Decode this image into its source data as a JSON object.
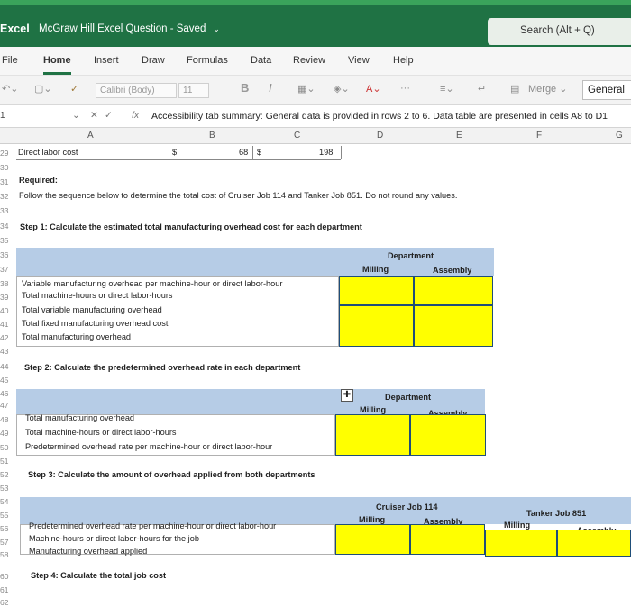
{
  "titlebar": {
    "app": "Excel",
    "doc_title": "McGraw Hill Excel Question - Saved",
    "search": "Search (Alt + Q)"
  },
  "menu": [
    "File",
    "Home",
    "Insert",
    "Draw",
    "Formulas",
    "Data",
    "Review",
    "View",
    "Help"
  ],
  "ribbon": {
    "font": "Calibri (Body)",
    "size": "11",
    "bold": "B",
    "italic": "I",
    "more": "···",
    "merge": "Merge",
    "number_format": "General"
  },
  "formula_bar": {
    "cell": "1",
    "fx": "fx",
    "content": "Accessibility tab summary: General data is provided in rows 2 to 6. Data table are presented in cells A8 to D1"
  },
  "columns": [
    "A",
    "B",
    "C",
    "D",
    "E",
    "F",
    "G"
  ],
  "row_numbers": [
    "29",
    "30",
    "31",
    "32",
    "33",
    "34",
    "35",
    "36",
    "37",
    "38",
    "39",
    "40",
    "41",
    "42",
    "43",
    "44",
    "45",
    "46",
    "47",
    "48",
    "49",
    "50",
    "51",
    "52",
    "53",
    "54",
    "55",
    "56",
    "57",
    "58",
    "59",
    "60",
    "61",
    "62"
  ],
  "row29": {
    "label": "Direct labor cost",
    "cur1": "$",
    "val1": "68",
    "cur2": "$",
    "val2": "198"
  },
  "required": {
    "title": "Required:",
    "text": "Follow the sequence below to determine the total cost of Cruiser Job 114 and Tanker Job 851. Do not round any values."
  },
  "step1": {
    "title": "Step 1: Calculate the estimated total manufacturing overhead cost for each department",
    "department": "Department",
    "milling": "Milling",
    "assembly": "Assembly",
    "rows": [
      "Variable manufacturing overhead per machine-hour or direct labor-hour",
      "Total machine-hours or direct labor-hours",
      "Total variable manufacturing overhead",
      "Total fixed manufacturing overhead cost",
      "Total manufacturing overhead"
    ]
  },
  "step2": {
    "title": "Step 2: Calculate the predetermined overhead rate in each department",
    "department": "Department",
    "milling": "Milling",
    "assembly": "Assembly",
    "rows": [
      "Total manufacturing overhead",
      "Total machine-hours or direct labor-hours",
      "Predetermined overhead rate per machine-hour or direct labor-hour"
    ]
  },
  "step3": {
    "title": "Step 3: Calculate the amount of overhead applied from both departments",
    "job1": "Cruiser Job 114",
    "job2": "Tanker Job 851",
    "milling": "Milling",
    "assembly": "Assembly",
    "rows": [
      "Predetermined overhead rate per machine-hour or direct labor-hour",
      "Machine-hours or direct labor-hours for the job",
      "Manufacturing overhead applied"
    ]
  },
  "step4": {
    "title": "Step 4: Calculate the total job cost"
  },
  "colors": {
    "excel_green": "#1f7244",
    "header_blue": "#b6cce6",
    "input_yellow": "#ffff00"
  }
}
